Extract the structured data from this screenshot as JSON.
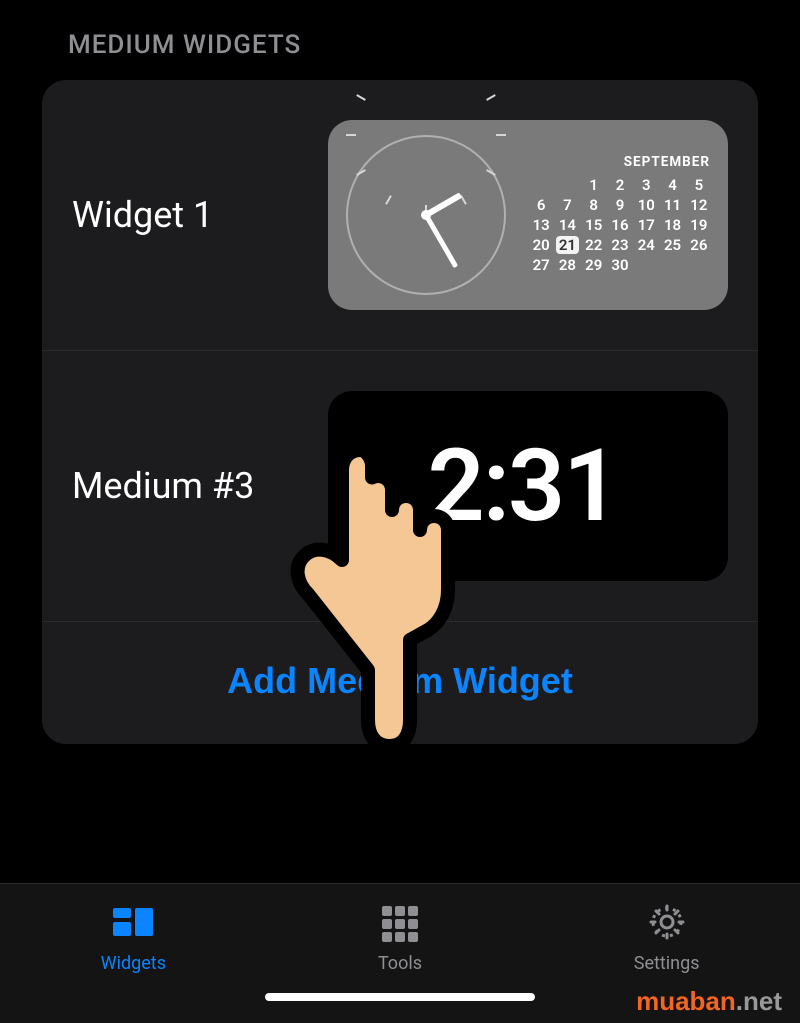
{
  "section_header": "MEDIUM WIDGETS",
  "widgets": [
    {
      "label": "Widget 1",
      "preview": {
        "month": "SEPTEMBER",
        "today": 21,
        "days": [
          [
            "",
            "",
            "1",
            "2",
            "3",
            "4",
            "5",
            "6"
          ],
          [
            "7",
            "8",
            "9",
            "10",
            "11",
            "12",
            "13"
          ],
          [
            "14",
            "15",
            "16",
            "17",
            "18",
            "19",
            "20"
          ],
          [
            "21",
            "22",
            "23",
            "24",
            "25",
            "26",
            "27"
          ],
          [
            "28",
            "29",
            "30",
            "",
            "",
            "",
            ""
          ]
        ]
      }
    },
    {
      "label": "Medium #3",
      "preview": {
        "time": "2:31"
      }
    }
  ],
  "add_button": "Add Medium Widget",
  "tabs": {
    "widgets": "Widgets",
    "tools": "Tools",
    "settings": "Settings"
  },
  "watermark": {
    "brand": "muaban",
    "tld": ".net"
  }
}
